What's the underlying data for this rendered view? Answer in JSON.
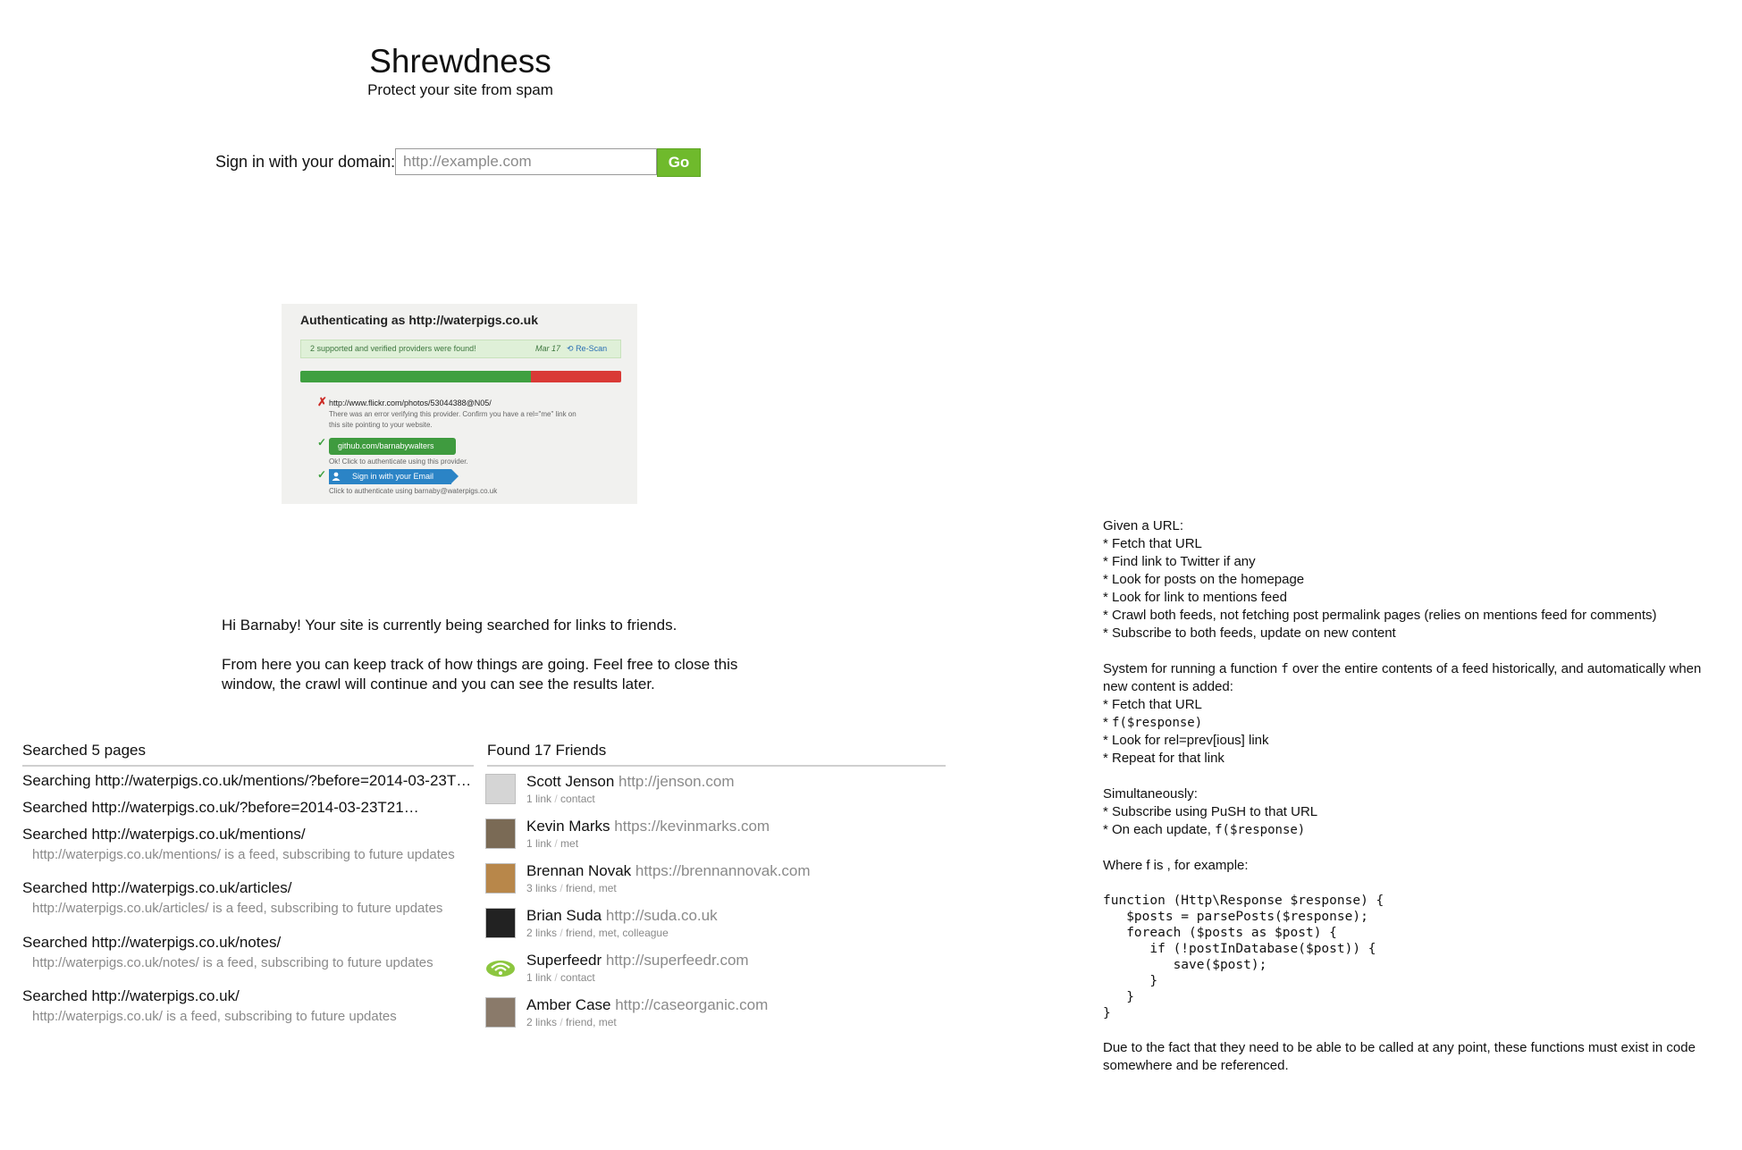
{
  "header": {
    "title": "Shrewdness",
    "subtitle": "Protect your site from spam"
  },
  "signin": {
    "label": "Sign in with your domain:",
    "placeholder": "http://example.com",
    "button_label": "Go"
  },
  "auth_screenshot": {
    "title": "Authenticating as http://waterpigs.co.uk",
    "alert_text": "2 supported and verified providers were found!",
    "alert_date": "Mar 17",
    "rescan_label": "Re-Scan",
    "progress_ok_fraction": 0.72,
    "providers": [
      {
        "status": "error",
        "status_icon": "✗",
        "url": "http://www.flickr.com/photos/53044388@N05/",
        "note_line1": "There was an error verifying this provider. Confirm you have a rel=\"me\" link on",
        "note_line2": "this site pointing to your website."
      },
      {
        "status": "ok",
        "status_icon": "✓",
        "button_label": "github.com/barnabywalters",
        "note": "Ok! Click to authenticate using this provider."
      },
      {
        "status": "ok",
        "status_icon": "✓",
        "button_label": "Sign in with your Email",
        "note": "Click to authenticate using barnaby@waterpigs.co.uk"
      }
    ]
  },
  "intro": {
    "line1": "Hi Barnaby! Your site is currently being searched for links to friends.",
    "line2": "From here you can keep track of how things are going. Feel free to close this",
    "line3": "window, the crawl will continue and you can see the results later."
  },
  "searched": {
    "heading": "Searched 5 pages",
    "items": [
      {
        "text": "Searching http://waterpigs.co.uk/mentions/?before=2014-03-23T…",
        "sub": ""
      },
      {
        "text": "Searched http://waterpigs.co.uk/?before=2014-03-23T21…",
        "sub": ""
      },
      {
        "text": "Searched http://waterpigs.co.uk/mentions/",
        "sub": "http://waterpigs.co.uk/mentions/ is a feed, subscribing to future updates"
      },
      {
        "text": "Searched http://waterpigs.co.uk/articles/",
        "sub": "http://waterpigs.co.uk/articles/ is a feed, subscribing to future updates"
      },
      {
        "text": "Searched http://waterpigs.co.uk/notes/",
        "sub": "http://waterpigs.co.uk/notes/ is a feed, subscribing to future updates"
      },
      {
        "text": "Searched http://waterpigs.co.uk/",
        "sub": "http://waterpigs.co.uk/ is a feed, subscribing to future updates"
      }
    ]
  },
  "friends": {
    "heading": "Found 17 Friends",
    "items": [
      {
        "name": "Scott Jenson",
        "url": "http://jenson.com",
        "links": "1 link",
        "rel": "contact",
        "avatar_color": "#d5d5d5"
      },
      {
        "name": "Kevin Marks",
        "url": "https://kevinmarks.com",
        "links": "1 link",
        "rel": "met",
        "avatar_color": "#7a6a55"
      },
      {
        "name": "Brennan Novak",
        "url": "https://brennannovak.com",
        "links": "3 links",
        "rel": "friend, met",
        "avatar_color": "#b8874a"
      },
      {
        "name": "Brian Suda",
        "url": "http://suda.co.uk",
        "links": "2 links",
        "rel": "friend, met, colleague",
        "avatar_color": "#222222"
      },
      {
        "name": "Superfeedr",
        "url": "http://superfeedr.com",
        "links": "1 link",
        "rel": "contact",
        "avatar_color": "#8cc63f"
      },
      {
        "name": "Amber Case",
        "url": "http://caseorganic.com",
        "links": "2 links",
        "rel": "friend, met",
        "avatar_color": "#8a7a6a"
      }
    ]
  },
  "notes": {
    "block1": [
      "Given a URL:",
      "* Fetch that URL",
      "* Find link to Twitter if any",
      "* Look for posts on the homepage",
      "* Look for link to mentions feed",
      "* Crawl both feeds, not fetching post permalink pages (relies on mentions feed for comments)",
      "* Subscribe to both feeds, update on new content"
    ],
    "block2_line1_pre": "System for running a function ",
    "block2_line1_code": "f",
    "block2_line1_post": " over the entire contents of a feed historically, and automatically when",
    "block2_line2": "new content is added:",
    "block2_item1": "* Fetch that URL",
    "block2_item2_pre": "* ",
    "block2_item2_code": "f($response)",
    "block2_item3": "* Look for rel=prev[ious] link",
    "block2_item4": "* Repeat for that link",
    "block3_line1": "Simultaneously:",
    "block3_item1": "* Subscribe using PuSH to that URL",
    "block3_item2_pre": "* On each update, ",
    "block3_item2_code": "f($response)",
    "where_line": "Where f is , for example:",
    "code": "function (Http\\Response $response) {\n   $posts = parsePosts($response);\n   foreach ($posts as $post) {\n      if (!postInDatabase($post)) {\n         save($post);\n      }\n   }\n}",
    "footer_line1": "Due to the fact that they need to be able to be called at any point, these functions must exist in code",
    "footer_line2": "somewhere and be referenced."
  }
}
